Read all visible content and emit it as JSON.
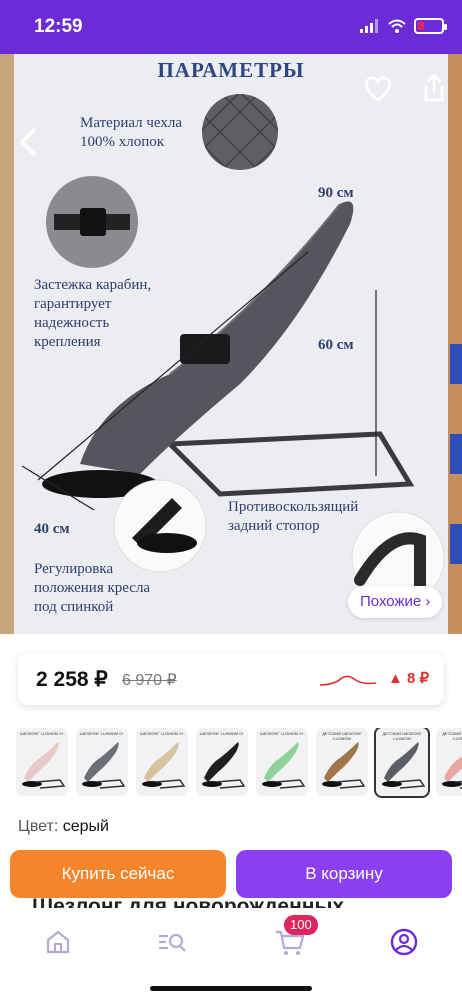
{
  "status": {
    "time": "12:59"
  },
  "hero": {
    "title": "ПАРАМЕТРЫ",
    "material_label_1": "Материал чехла",
    "material_label_2": "100% хлопок",
    "clasp_label_1": "Застежка карабин,",
    "clasp_label_2": "гарантирует",
    "clasp_label_3": "надежность",
    "clasp_label_4": "крепления",
    "dim_length": "90 см",
    "dim_height": "60 см",
    "dim_width": "40 см",
    "adjust_label_1": "Регулировка",
    "adjust_label_2": "положения кресла",
    "adjust_label_3": "под спинкой",
    "stopper_label_1": "Противоскользящий",
    "stopper_label_2": "задний стопор",
    "back_icon": "chevron-left-icon",
    "favorite_icon": "heart-icon",
    "share_icon": "share-icon",
    "similar_label": "Похожие ›"
  },
  "price": {
    "current": "2 258 ₽",
    "old": "6 970 ₽",
    "delta": "▲ 8 ₽",
    "delta_color": "#e03030"
  },
  "thumbnails": [
    {
      "label": "ШЕЗЛОНГ LUXMOM 0+",
      "color": "#e8c9c9",
      "selected": false
    },
    {
      "label": "ШЕЗЛОНГ LUXMOM 0+",
      "color": "#6b6f78",
      "selected": false
    },
    {
      "label": "ШЕЗЛОНГ LUXMOM 0+",
      "color": "#d8c29e",
      "selected": false
    },
    {
      "label": "ШЕЗЛОНГ LUXMOM 0+",
      "color": "#1f1f22",
      "selected": false
    },
    {
      "label": "ШЕЗЛОНГ LUXMOM 0+",
      "color": "#8fd19a",
      "selected": false
    },
    {
      "label": "ДЕТСКИЙ ШЕЗЛОНГ LUXMOM",
      "color": "#a0774a",
      "selected": false
    },
    {
      "label": "ДЕТСКИЙ ШЕЗЛОНГ LUXMOM",
      "color": "#5d5f68",
      "selected": true
    },
    {
      "label": "ДЕТСКИЙ ШЕЗЛОНГ LUXMOM",
      "color": "#e9a7a3",
      "selected": false
    }
  ],
  "color": {
    "label": "Цвет:",
    "value": "серый"
  },
  "actions": {
    "buy": "Купить сейчас",
    "cart": "В корзину"
  },
  "behind_title": "Шезлонг для новорожденных",
  "tabbar": {
    "items": [
      "home-icon",
      "catalog-search-icon",
      "cart-icon",
      "profile-icon"
    ],
    "cart_badge": "100"
  },
  "colors": {
    "brand": "#6c2bd9",
    "buy": "#f5842a",
    "cart": "#8a3ff2"
  }
}
